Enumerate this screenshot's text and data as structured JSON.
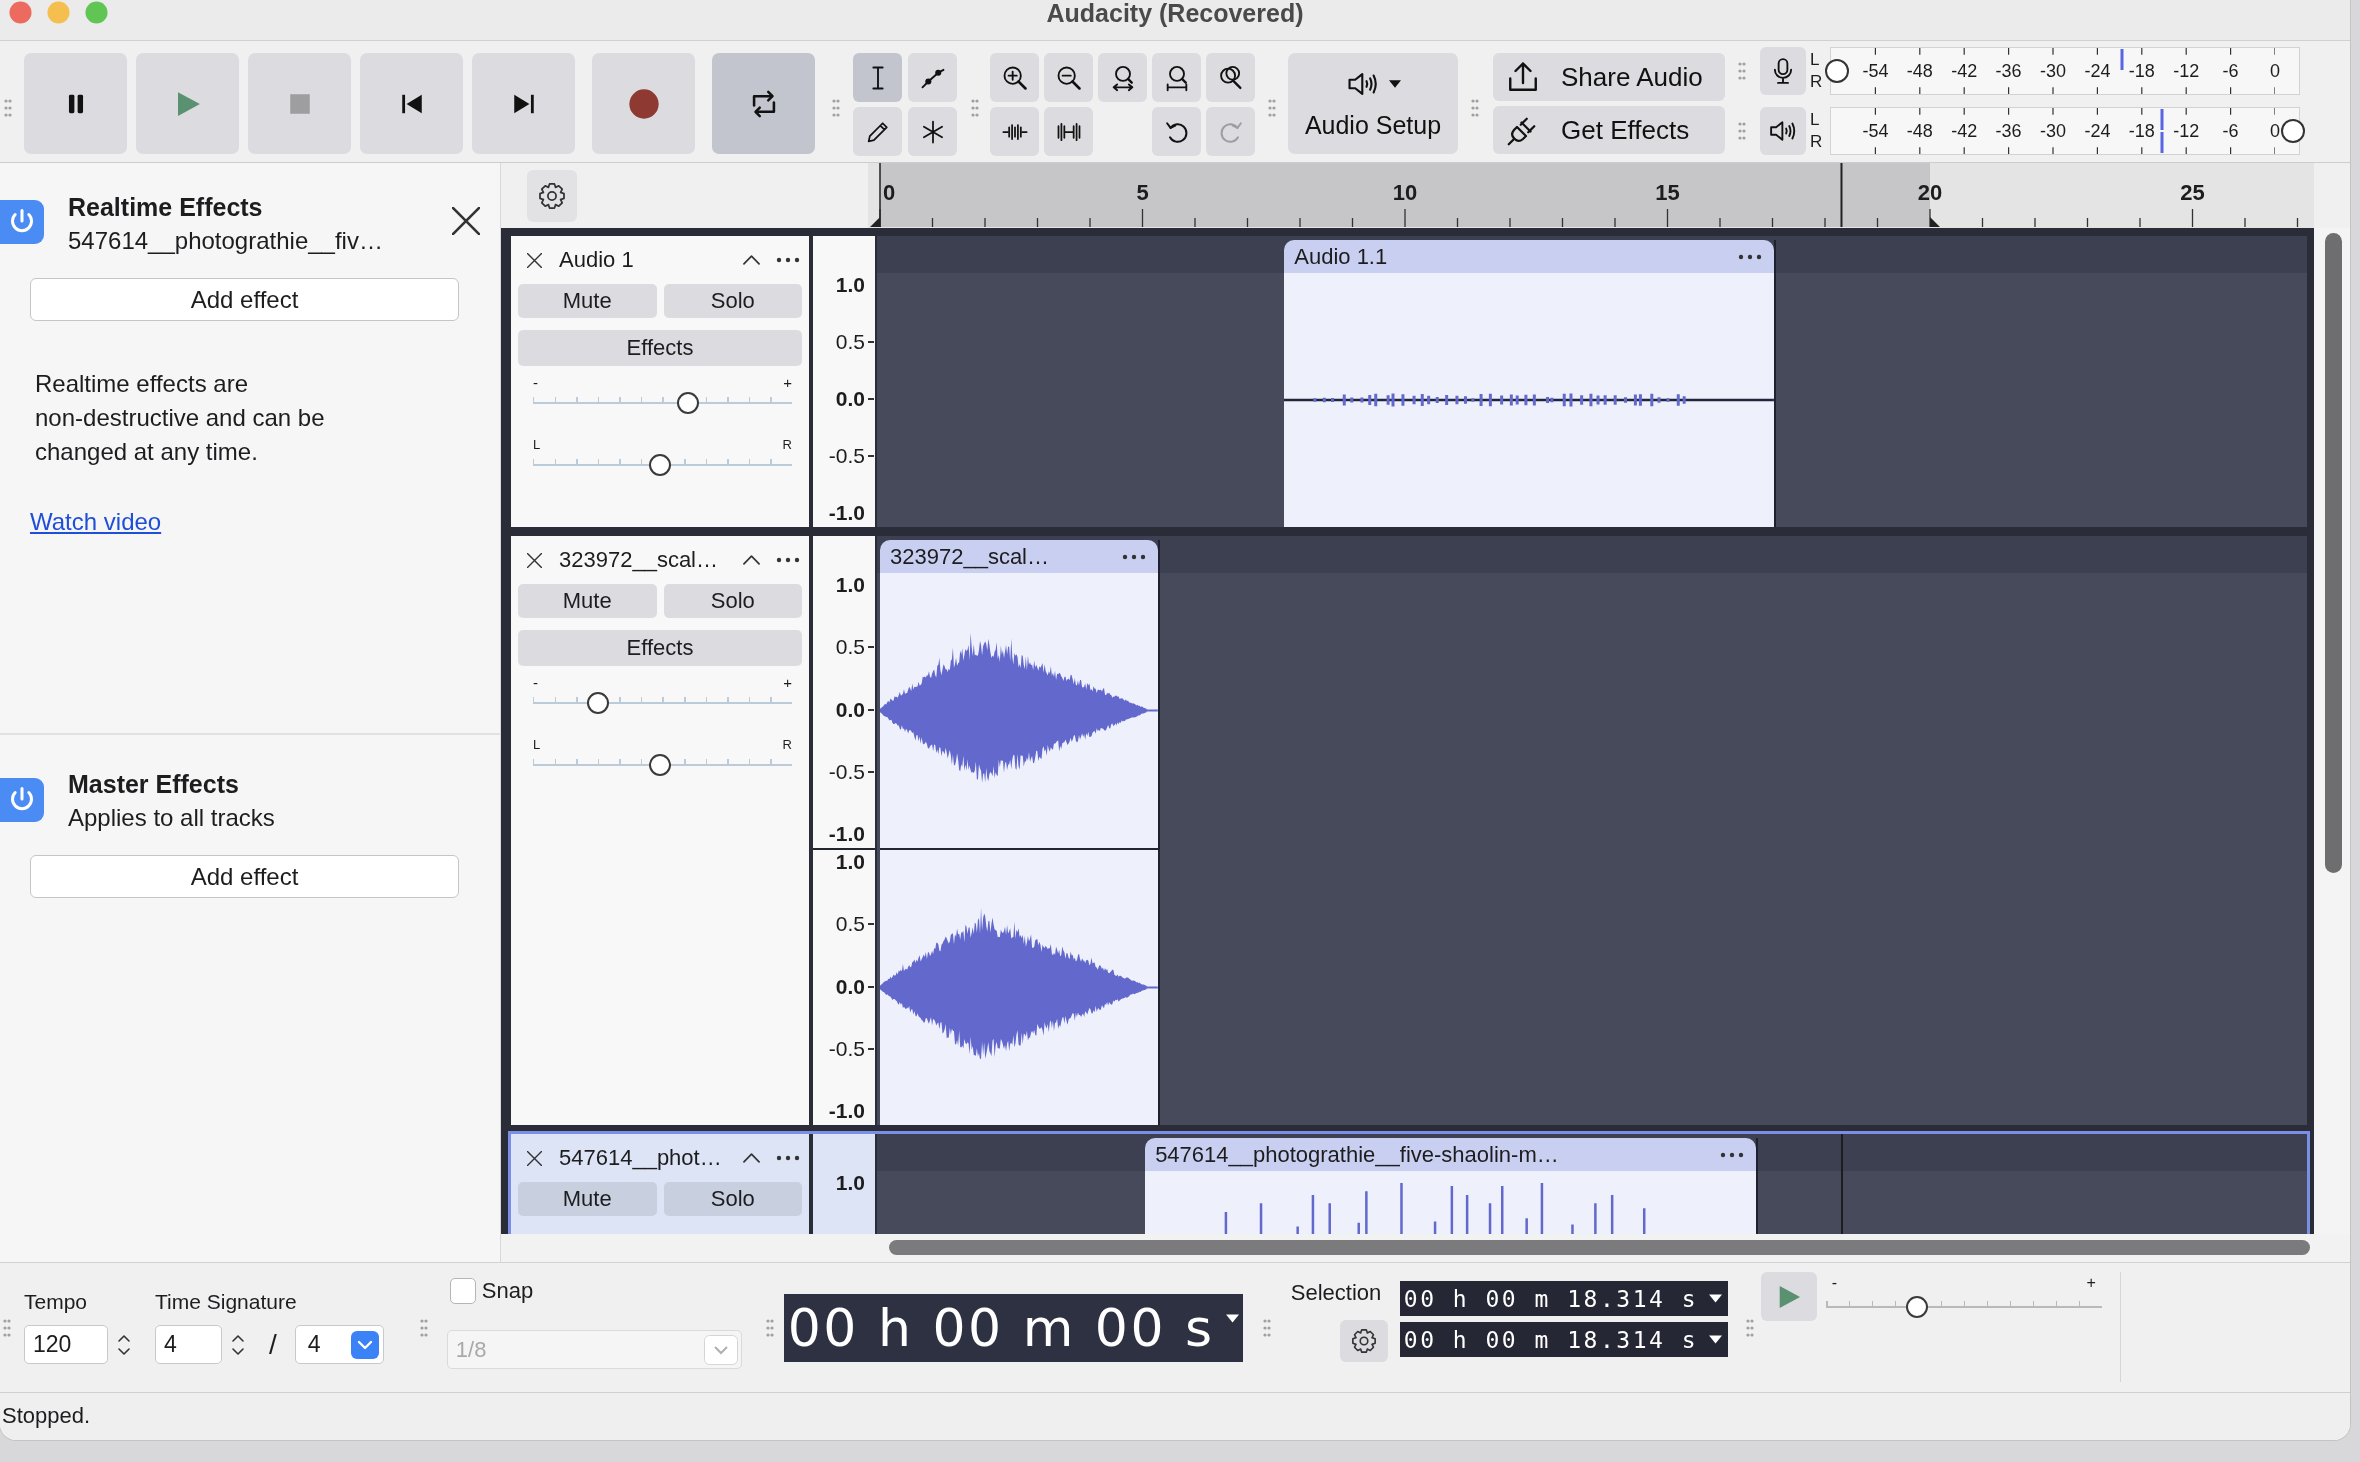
{
  "window": {
    "title": "Audacity (Recovered)"
  },
  "transport": [
    {
      "kind": "pause",
      "on": false,
      "disabled": false
    },
    {
      "kind": "play",
      "on": false,
      "disabled": false
    },
    {
      "kind": "stop",
      "on": false,
      "disabled": true
    },
    {
      "kind": "skip_start",
      "on": false,
      "disabled": false
    },
    {
      "kind": "skip_end",
      "on": false,
      "disabled": false
    },
    {
      "kind": "record",
      "on": false,
      "disabled": false
    },
    {
      "kind": "loop",
      "on": true,
      "disabled": false
    }
  ],
  "tools": [
    {
      "kind": "select",
      "selected": true
    },
    {
      "kind": "envelope",
      "selected": false
    },
    {
      "kind": "draw",
      "selected": false
    },
    {
      "kind": "multi",
      "selected": false
    }
  ],
  "edit_tools": [
    {
      "kind": "zoom_in",
      "disabled": false
    },
    {
      "kind": "zoom_out",
      "disabled": false
    },
    {
      "kind": "fit_selection",
      "disabled": false
    },
    {
      "kind": "fit_project",
      "disabled": false
    },
    {
      "kind": "zoom_toggle",
      "disabled": false
    },
    {
      "kind": "trim",
      "disabled": false
    },
    {
      "kind": "silence",
      "disabled": false
    },
    {
      "kind": "undo",
      "disabled": false
    },
    {
      "kind": "redo",
      "disabled": true
    }
  ],
  "audio_setup": {
    "label": "Audio Setup"
  },
  "share_audio": {
    "label": "Share Audio"
  },
  "get_effects": {
    "label": "Get Effects"
  },
  "meters": [
    {
      "kind": "record",
      "volume": {
        "level": 0
      },
      "channels": [
        {
          "label": "L",
          "level": 0.655
        },
        {
          "label": "R"
        }
      ],
      "ticks": [
        "-54",
        "-48",
        "-42",
        "-36",
        "-30",
        "-24",
        "-18",
        "-12",
        "-6",
        "0"
      ]
    },
    {
      "kind": "playback",
      "volume": {
        "level": 1
      },
      "channels": [
        {
          "label": "L",
          "level": 0.745
        },
        {
          "label": "R",
          "level": 0.745
        }
      ],
      "ticks": [
        "-54",
        "-48",
        "-42",
        "-36",
        "-30",
        "-24",
        "-18",
        "-12",
        "-6",
        "0"
      ]
    }
  ],
  "realtime_effects": {
    "title": "Realtime Effects",
    "subtitle": "547614__photograthie__fiv…",
    "on": true,
    "add_button": "Add effect",
    "description": [
      "Realtime effects are",
      "non-destructive and can be",
      "changed at any time."
    ],
    "link": "Watch video"
  },
  "master_effects": {
    "title": "Master Effects",
    "subtitle": "Applies to all tracks",
    "on": true,
    "add_button": "Add effect"
  },
  "ruler": {
    "ticks": [
      "0",
      "5",
      "10",
      "15",
      "20",
      "25"
    ]
  },
  "tracks": [
    {
      "name": "Audio 1",
      "selected": false,
      "mute": "Mute",
      "solo": "Solo",
      "effects": "Effects",
      "gain": {
        "min": "-",
        "max": "+",
        "level": 0.6
      },
      "pan": {
        "min": "L",
        "max": "R",
        "level": 0.49
      },
      "channels": [
        {
          "scale": [
            {
              "label": "1.0",
              "major": true
            },
            {
              "label": "0.5",
              "major": false
            },
            {
              "label": "0.0",
              "major": true
            },
            {
              "label": "-0.5",
              "major": false
            },
            {
              "label": "-1.0",
              "major": true
            }
          ]
        }
      ],
      "clips": [
        {
          "name": "Audio 1.1",
          "kind": "quiet"
        }
      ]
    },
    {
      "name": "323972__scal…",
      "selected": false,
      "mute": "Mute",
      "solo": "Solo",
      "effects": "Effects",
      "gain": {
        "min": "-",
        "max": "+",
        "level": 0.25
      },
      "pan": {
        "min": "L",
        "max": "R",
        "level": 0.49
      },
      "channels": [
        {
          "scale": [
            {
              "label": "1.0",
              "major": true
            },
            {
              "label": "0.5",
              "major": false
            },
            {
              "label": "0.0",
              "major": true
            },
            {
              "label": "-0.5",
              "major": false
            },
            {
              "label": "-1.0",
              "major": true
            }
          ]
        },
        {
          "scale": [
            {
              "label": "1.0",
              "major": true
            },
            {
              "label": "0.5",
              "major": false
            },
            {
              "label": "0.0",
              "major": true
            },
            {
              "label": "-0.5",
              "major": false
            },
            {
              "label": "-1.0",
              "major": true
            }
          ]
        }
      ],
      "clips": [
        {
          "name": "323972__scal…",
          "kind": "diamond"
        }
      ]
    },
    {
      "name": "547614__phot…",
      "selected": true,
      "mute": "Mute",
      "solo": "Solo",
      "channels": [
        {
          "scale": [
            {
              "label": "1.0",
              "major": true
            }
          ]
        }
      ],
      "clips": [
        {
          "name": "547614__photograthie__five-shaolin-m…",
          "kind": "spikes"
        }
      ]
    }
  ],
  "tempo": {
    "label": "Tempo",
    "value": "120"
  },
  "time_signature": {
    "label": "Time Signature",
    "upper": "4",
    "separator": "/",
    "lower": "4"
  },
  "snap": {
    "label": "Snap",
    "checked": false,
    "value": "1/8",
    "disabled": true
  },
  "time_display": {
    "value": "00 h 00 m 00 s"
  },
  "selection": {
    "label": "Selection",
    "start": "00 h 00 m 18.314 s",
    "end": "00 h 00 m 18.314 s"
  },
  "play_at_speed": {
    "min": "-",
    "max": "+",
    "level": 0.33
  },
  "status_bar": {
    "text": "Stopped."
  }
}
